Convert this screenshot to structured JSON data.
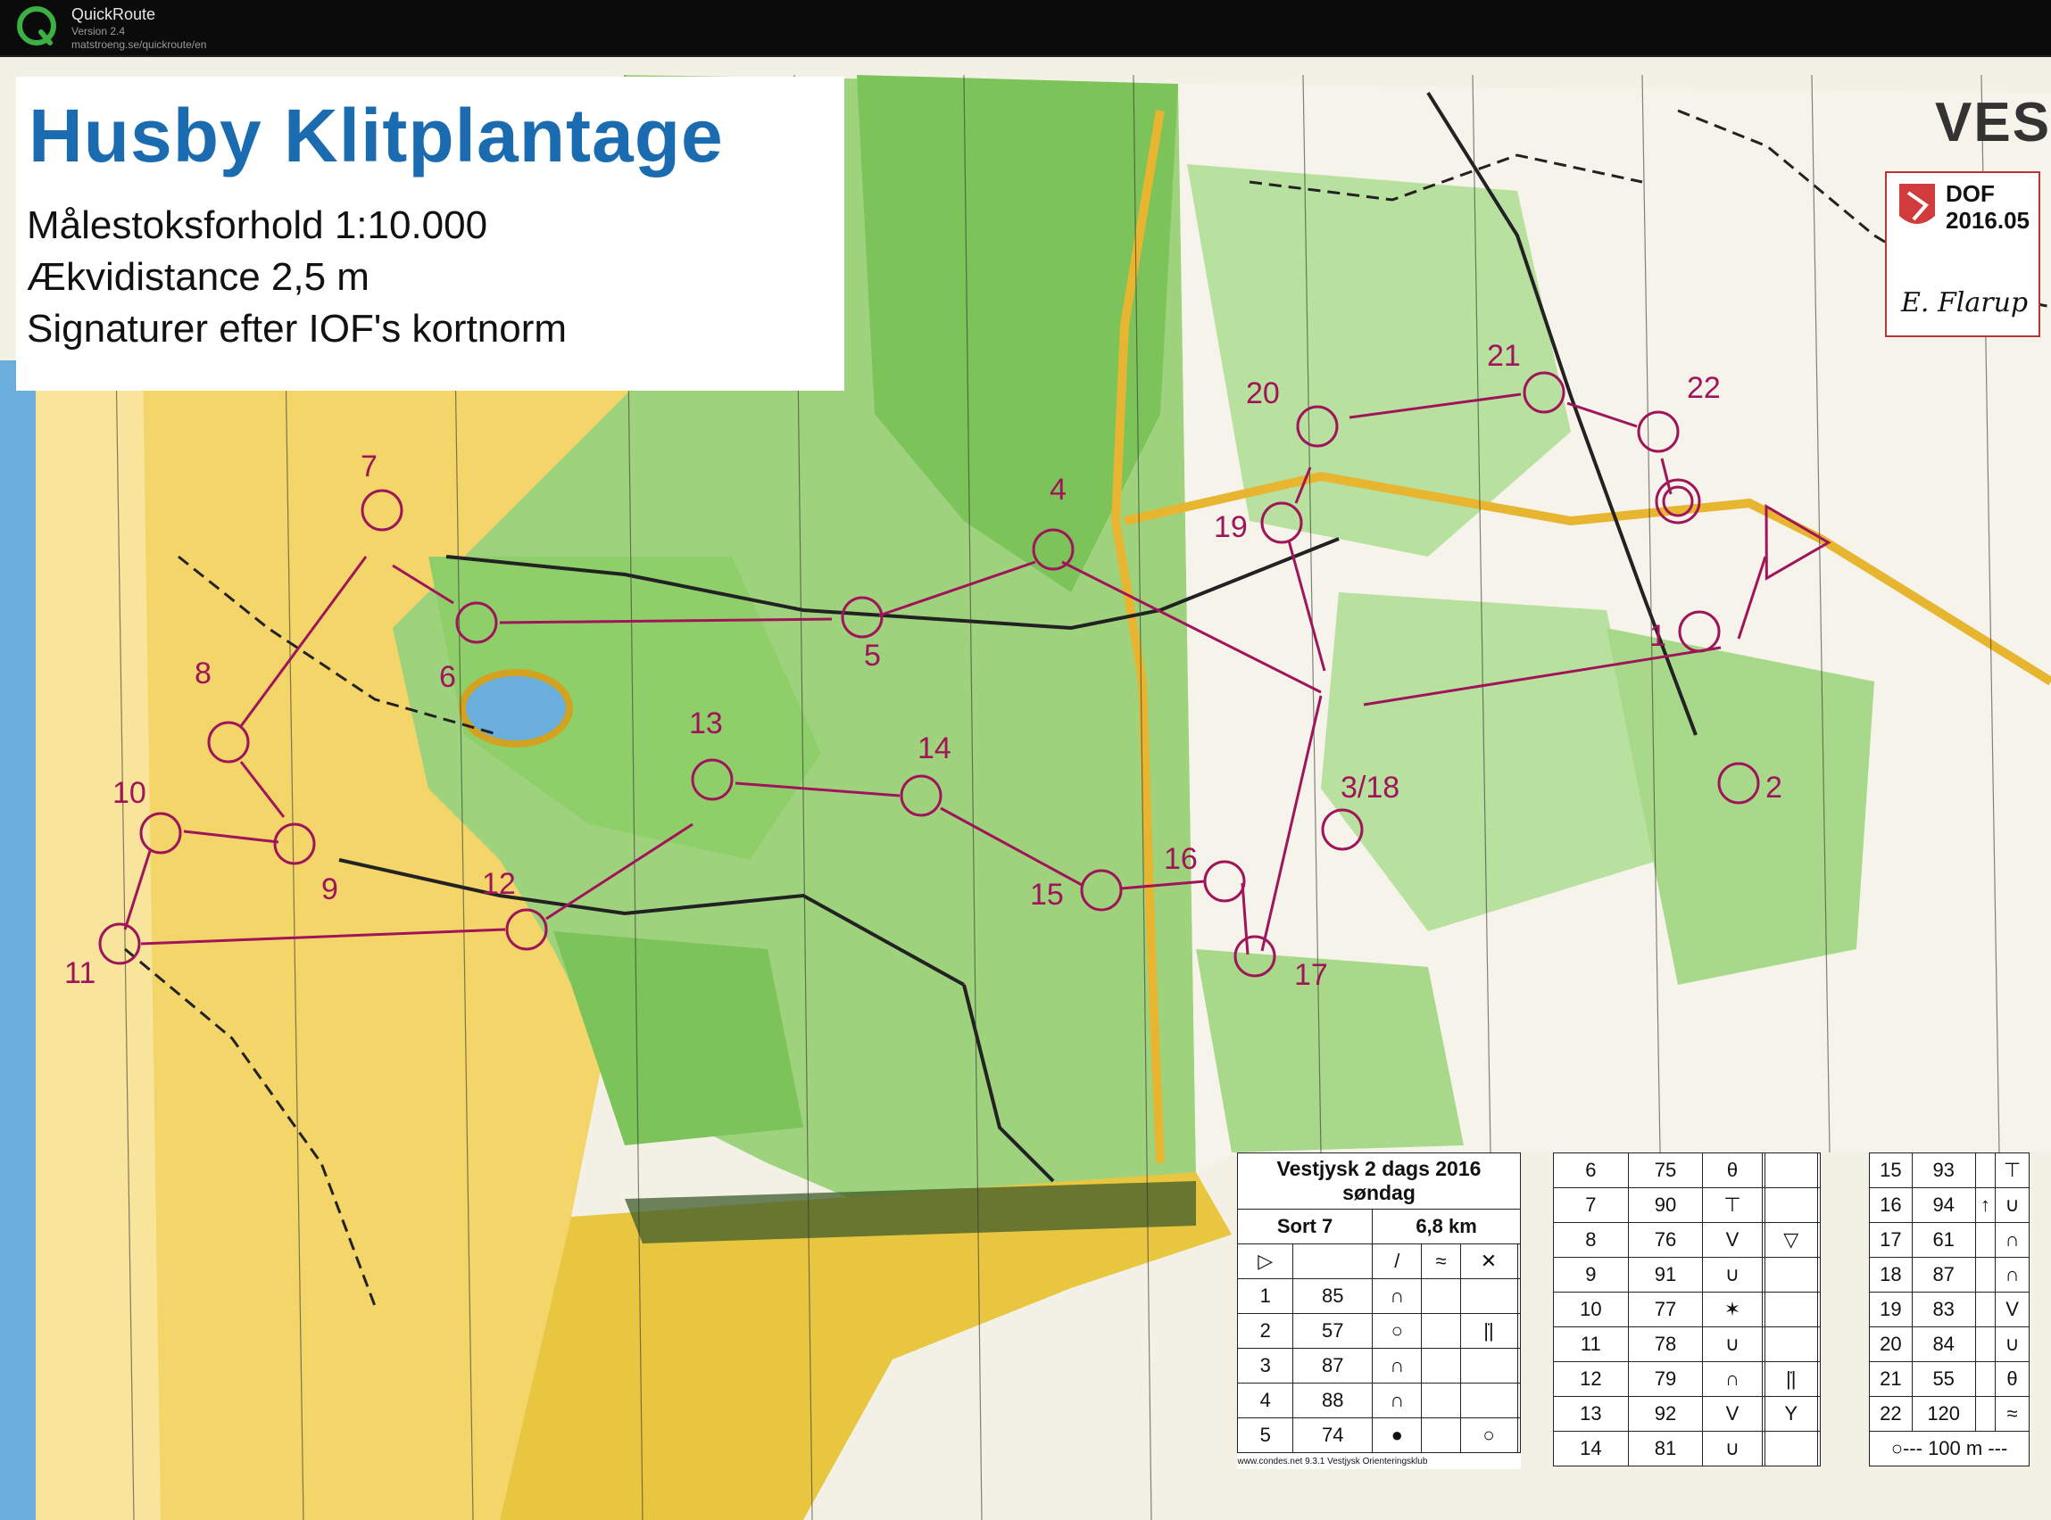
{
  "app": {
    "name": "QuickRoute",
    "version": "Version 2.4",
    "url": "matstroeng.se/quickroute/en"
  },
  "map": {
    "title": "Husby Klitplantage",
    "subtitle_lines": [
      "Målestoksforhold 1:10.000",
      "Ækvidistance 2,5 m",
      "Signaturer efter IOF's kortnorm"
    ],
    "corner_label": "VEST",
    "dof": {
      "label": "DOF",
      "version": "2016.05",
      "signature": "E. Flarup"
    },
    "controls": [
      {
        "label": "1"
      },
      {
        "label": "2"
      },
      {
        "label": "3/18"
      },
      {
        "label": "4"
      },
      {
        "label": "5"
      },
      {
        "label": "6"
      },
      {
        "label": "7"
      },
      {
        "label": "8"
      },
      {
        "label": "9"
      },
      {
        "label": "10"
      },
      {
        "label": "11"
      },
      {
        "label": "12"
      },
      {
        "label": "13"
      },
      {
        "label": "14"
      },
      {
        "label": "15"
      },
      {
        "label": "16"
      },
      {
        "label": "17"
      },
      {
        "label": "19"
      },
      {
        "label": "20"
      },
      {
        "label": "21"
      },
      {
        "label": "22"
      }
    ],
    "colors": {
      "course": "#a0155a",
      "forest": "#8fcf6a",
      "open": "#f3d56a",
      "water": "#6aaedc"
    }
  },
  "description": {
    "event_line1": "Vestjysk 2 dags 2016",
    "event_line2": "søndag",
    "course": "Sort 7",
    "length": "6,8 km",
    "rows1": [
      {
        "n": "1",
        "code": "85",
        "sym": "∩",
        "extra": ""
      },
      {
        "n": "2",
        "code": "57",
        "sym": "○",
        "extra": "|̇|"
      },
      {
        "n": "3",
        "code": "87",
        "sym": "∩",
        "extra": ""
      },
      {
        "n": "4",
        "code": "88",
        "sym": "∩",
        "extra": ""
      },
      {
        "n": "5",
        "code": "74",
        "sym": "●",
        "extra": "○"
      }
    ],
    "rows2": [
      {
        "n": "6",
        "code": "75",
        "sym": "θ",
        "extra": ""
      },
      {
        "n": "7",
        "code": "90",
        "sym": "⊤",
        "extra": ""
      },
      {
        "n": "8",
        "code": "76",
        "sym": "V",
        "extra": "▽"
      },
      {
        "n": "9",
        "code": "91",
        "sym": "∪",
        "extra": ""
      },
      {
        "n": "10",
        "code": "77",
        "sym": "✶",
        "extra": ""
      },
      {
        "n": "11",
        "code": "78",
        "sym": "∪",
        "extra": ""
      },
      {
        "n": "12",
        "code": "79",
        "sym": "∩",
        "extra": "|̇|"
      },
      {
        "n": "13",
        "code": "92",
        "sym": "V",
        "extra": "Y"
      },
      {
        "n": "14",
        "code": "81",
        "sym": "∪",
        "extra": ""
      }
    ],
    "rows3": [
      {
        "n": "15",
        "code": "93",
        "sym": "⊤"
      },
      {
        "n": "16",
        "code": "94",
        "sym": "∪"
      },
      {
        "n": "17",
        "code": "61",
        "sym": "∩"
      },
      {
        "n": "18",
        "code": "87",
        "sym": "∩"
      },
      {
        "n": "19",
        "code": "83",
        "sym": "V"
      },
      {
        "n": "20",
        "code": "84",
        "sym": "∪"
      },
      {
        "n": "21",
        "code": "55",
        "sym": "θ"
      },
      {
        "n": "22",
        "code": "120",
        "sym": "≈"
      }
    ],
    "finish": "○--- 100 m ---",
    "footer": "www.condes.net 9.3.1 Vestjysk Orienteringsklub"
  }
}
